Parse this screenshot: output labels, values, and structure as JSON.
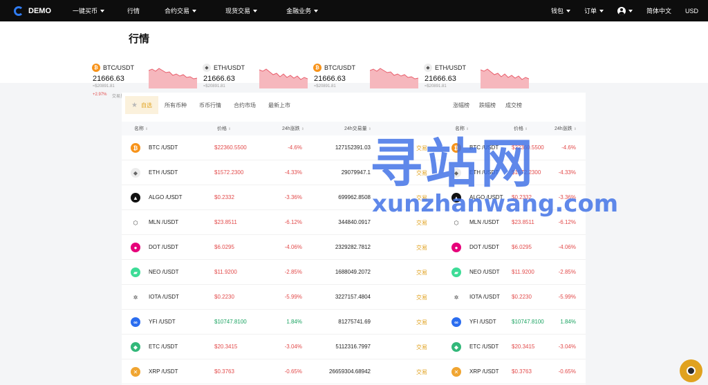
{
  "nav": {
    "brand": "DEMO",
    "items": [
      {
        "label": "一键买币",
        "caret": true
      },
      {
        "label": "行情",
        "caret": false
      },
      {
        "label": "合约交易",
        "caret": true
      },
      {
        "label": "现货交易",
        "caret": true
      },
      {
        "label": "金融业务",
        "caret": true
      }
    ],
    "wallet": "钱包",
    "orders": "订单",
    "language": "简体中文",
    "currency": "USD"
  },
  "page": {
    "title": "行情"
  },
  "tickers": [
    {
      "pair": "BTC/USDT",
      "coin": "BTC",
      "price": "21666.63",
      "sub": "≈$20891.81",
      "change": "+2.97%",
      "volume": "交易量"
    },
    {
      "pair": "ETH/USDT",
      "coin": "ETH",
      "price": "21666.63",
      "sub": "≈$20891.81",
      "change": "",
      "volume": ""
    },
    {
      "pair": "BTC/USDT",
      "coin": "BTC",
      "price": "21666.63",
      "sub": "≈$20891.81",
      "change": "",
      "volume": ""
    },
    {
      "pair": "ETH/USDT",
      "coin": "ETH",
      "price": "21666.63",
      "sub": "≈$20891.81",
      "change": "",
      "volume": ""
    }
  ],
  "main_tabs": [
    "自选",
    "所有币种",
    "币币行情",
    "合约市场",
    "最新上市"
  ],
  "right_tabs": [
    "涨幅榜",
    "跌幅榜",
    "成交榜"
  ],
  "table": {
    "headers": {
      "name": "名称",
      "price": "价格",
      "change": "24h涨跌",
      "volume": "24h交易量"
    },
    "trade_label": "交易",
    "rows": [
      {
        "coin": "BTC",
        "pair": "BTC /USDT",
        "price": "$22360.5500",
        "change": "-4.6%",
        "volume": "127152391.03",
        "up": false
      },
      {
        "coin": "ETH",
        "pair": "ETH /USDT",
        "price": "$1572.2300",
        "change": "-4.33%",
        "volume": "29079947.1",
        "up": false
      },
      {
        "coin": "ALGO",
        "pair": "ALGO /USDT",
        "price": "$0.2332",
        "change": "-3.36%",
        "volume": "699962.8508",
        "up": false
      },
      {
        "coin": "MLN",
        "pair": "MLN /USDT",
        "price": "$23.8511",
        "change": "-6.12%",
        "volume": "344840.0917",
        "up": false
      },
      {
        "coin": "DOT",
        "pair": "DOT /USDT",
        "price": "$6.0295",
        "change": "-4.06%",
        "volume": "2329282.7812",
        "up": false
      },
      {
        "coin": "NEO",
        "pair": "NEO /USDT",
        "price": "$11.9200",
        "change": "-2.85%",
        "volume": "1688049.2072",
        "up": false
      },
      {
        "coin": "IOTA",
        "pair": "IOTA /USDT",
        "price": "$0.2230",
        "change": "-5.99%",
        "volume": "3227157.4804",
        "up": false
      },
      {
        "coin": "YFI",
        "pair": "YFI /USDT",
        "price": "$10747.8100",
        "change": "1.84%",
        "volume": "81275741.69",
        "up": true
      },
      {
        "coin": "ETC",
        "pair": "ETC /USDT",
        "price": "$20.3415",
        "change": "-3.04%",
        "volume": "5112316.7997",
        "up": false
      },
      {
        "coin": "XRP",
        "pair": "XRP /USDT",
        "price": "$0.3763",
        "change": "-0.65%",
        "volume": "26659304.68942",
        "up": false
      }
    ]
  },
  "coin_colors": {
    "BTC": "#f7931a",
    "ETH": "#ececec",
    "ALGO": "#111111",
    "MLN": "#ffffff",
    "DOT": "#e6007a",
    "NEO": "#3ddc97",
    "IOTA": "#ffffff",
    "YFI": "#2b6def",
    "ETC": "#33b87a",
    "XRP": "#f0a531"
  },
  "watermark": {
    "cn": "寻站网",
    "en": "xunzhanwang.com"
  }
}
